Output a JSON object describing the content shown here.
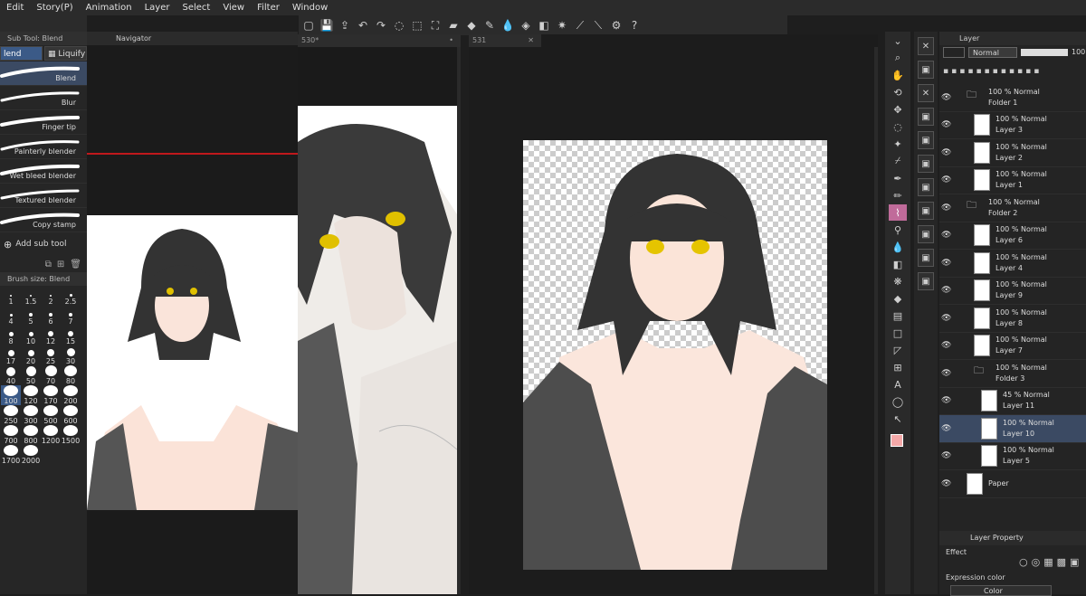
{
  "menu": [
    "Edit",
    "Story(P)",
    "Animation",
    "Layer",
    "Select",
    "View",
    "Filter",
    "Window"
  ],
  "toolbar_icons": [
    "new-icon",
    "save-icon",
    "export-icon",
    "undo-icon",
    "redo-icon",
    "lasso-icon",
    "select-all-icon",
    "transform-icon",
    "erase-icon",
    "color-icon",
    "pen-icon",
    "blend-icon",
    "fill-icon",
    "ruler-icon",
    "sparkle-icon",
    "brush-stroke-icon",
    "eraser-stroke-icon",
    "gear-icon",
    "help-icon"
  ],
  "subtool": {
    "title": "Sub Tool: Blend",
    "tabs": [
      "lend",
      "Liquify"
    ],
    "brushes": [
      "Blend",
      "Blur",
      "Finger tip",
      "Painterly blender",
      "Wet bleed blender",
      "Textured blender",
      "Copy stamp"
    ],
    "add_label": "Add sub tool"
  },
  "brush_size": {
    "title": "Brush size: Blend",
    "values": [
      "1",
      "1.5",
      "2",
      "2.5",
      "4",
      "5",
      "6",
      "7",
      "8",
      "10",
      "12",
      "15",
      "17",
      "20",
      "25",
      "30",
      "40",
      "50",
      "70",
      "80",
      "100",
      "120",
      "170",
      "200",
      "250",
      "300",
      "500",
      "600",
      "700",
      "800",
      "1200",
      "1500",
      "1700",
      "2000"
    ],
    "selected": "100"
  },
  "navigator": {
    "title": "Navigator"
  },
  "tabs": {
    "t530": "530*",
    "t531": "531"
  },
  "layer_panel": {
    "title": "Layer",
    "blend_mode": "Normal",
    "opacity": "100",
    "layers": [
      {
        "mode": "100 % Normal",
        "name": "Folder 1",
        "folder": true,
        "indent": 0
      },
      {
        "mode": "100 % Normal",
        "name": "Layer 3",
        "indent": 1
      },
      {
        "mode": "100 % Normal",
        "name": "Layer 2",
        "indent": 1
      },
      {
        "mode": "100 % Normal",
        "name": "Layer 1",
        "indent": 1
      },
      {
        "mode": "100 % Normal",
        "name": "Folder 2",
        "folder": true,
        "indent": 0
      },
      {
        "mode": "100 % Normal",
        "name": "Layer 6",
        "indent": 1
      },
      {
        "mode": "100 % Normal",
        "name": "Layer 4",
        "indent": 1
      },
      {
        "mode": "100 % Normal",
        "name": "Layer 9",
        "indent": 1
      },
      {
        "mode": "100 % Normal",
        "name": "Layer 8",
        "indent": 1
      },
      {
        "mode": "100 % Normal",
        "name": "Layer 7",
        "indent": 1
      },
      {
        "mode": "100 % Normal",
        "name": "Folder 3",
        "folder": true,
        "indent": 1
      },
      {
        "mode": "45 % Normal",
        "name": "Layer 11",
        "indent": 2
      },
      {
        "mode": "100 % Normal",
        "name": "Layer 10",
        "indent": 2,
        "selected": true
      },
      {
        "mode": "100 % Normal",
        "name": "Layer 5",
        "indent": 2
      },
      {
        "mode": "",
        "name": "Paper",
        "indent": 0,
        "paper": true
      }
    ]
  },
  "layer_property": {
    "title": "Layer Property",
    "effect": "Effect",
    "expression_color": "Expression color",
    "color_value": "Color"
  },
  "colors": {
    "accent": "#3b5a87",
    "main_color": "#f4a8a8"
  }
}
